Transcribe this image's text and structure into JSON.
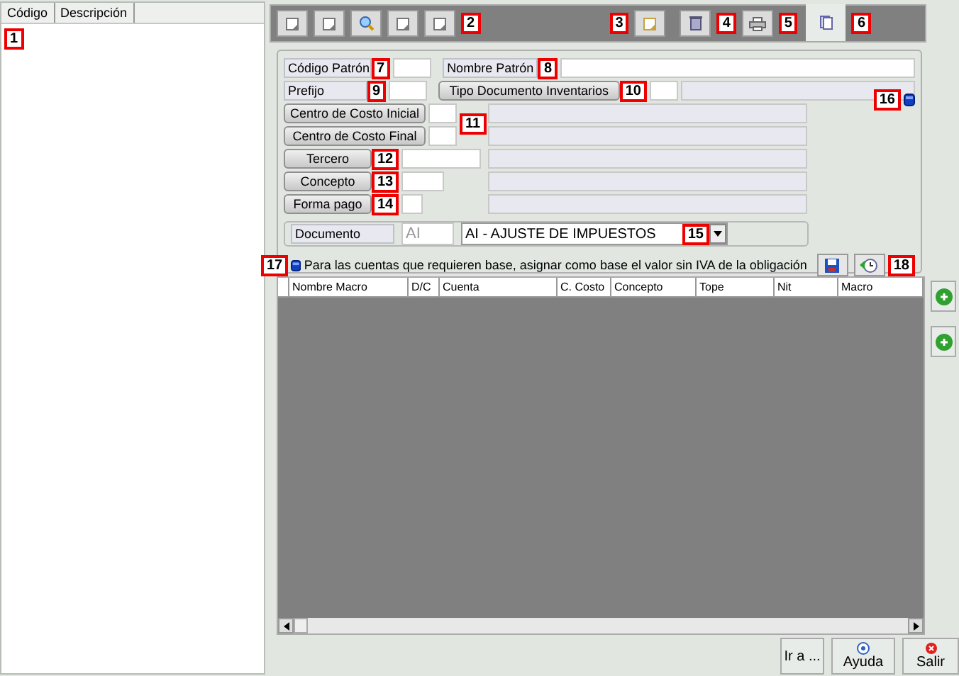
{
  "left_panel": {
    "columns": [
      "Código",
      "Descripción"
    ],
    "callout": "1"
  },
  "toolbar": {
    "callouts": [
      "2",
      "3",
      "4",
      "5",
      "6"
    ]
  },
  "header_fields": [
    {
      "label": "Código Patrón",
      "callout": "7"
    },
    {
      "label": "Nombre Patrón",
      "callout": "8"
    },
    {
      "label": "Prefijo",
      "callout": "9"
    }
  ],
  "tipo_documento": {
    "button": "Tipo Documento Inventarios",
    "callout": "10"
  },
  "lookups": [
    {
      "button": "Centro de Costo Inicial"
    },
    {
      "button": "Centro de Costo Final"
    },
    {
      "button": "Tercero",
      "callout": "12"
    },
    {
      "button": "Concepto",
      "callout": "13"
    },
    {
      "button": "Forma pago",
      "callout": "14"
    }
  ],
  "lookup_callouts": {
    "range": "11",
    "toggle": "16"
  },
  "documento": {
    "label": "Documento",
    "code": "AI",
    "value": "AI - AJUSTE DE IMPUESTOS",
    "callout": "15"
  },
  "option": {
    "text": "Para las cuentas que requieren base, asignar como base el valor sin IVA de la obligación",
    "callout": "17",
    "buttons_callout": "18"
  },
  "grid": {
    "columns": [
      "Nombre Macro",
      "D/C",
      "Cuenta",
      "C. Costo",
      "Concepto",
      "Tope",
      "Nit",
      "Macro"
    ]
  },
  "footer_buttons": [
    "Ir a ...",
    "Ayuda",
    "Salir"
  ]
}
